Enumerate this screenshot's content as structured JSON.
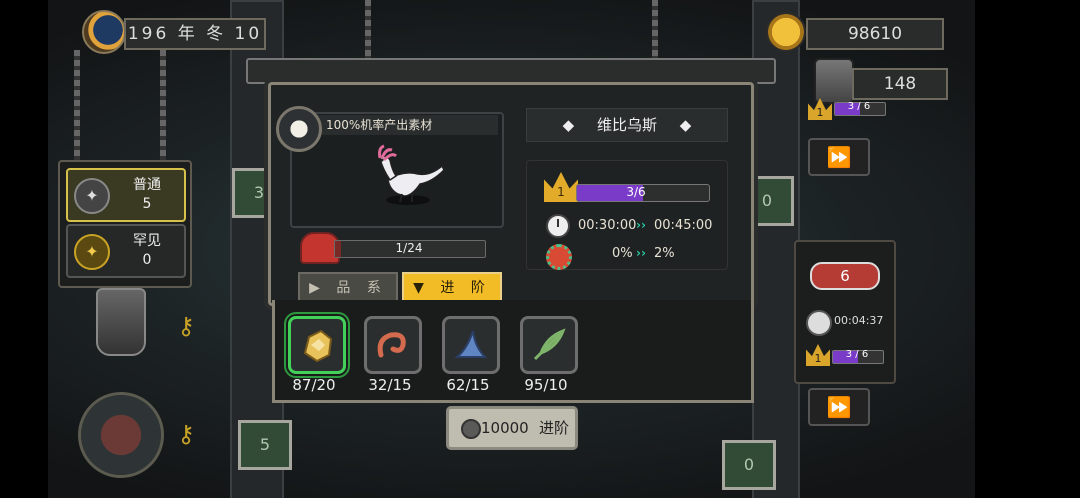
{
  "header": {
    "date": "196 年 冬 10",
    "gold": "98610",
    "barrels": "148"
  },
  "rarity_filter": {
    "items": [
      {
        "label": "普通",
        "count": "5"
      },
      {
        "label": "罕见",
        "count": "0"
      }
    ]
  },
  "right_panel": {
    "top_level_text": "3 / 6",
    "top_level_crown": "1",
    "meat_count": "6",
    "timer": "00:04:37",
    "level_crown": "1",
    "level_text": "3 / 6",
    "level_progress": 0.5
  },
  "side_plates": {
    "left_top": "3",
    "right_top": "0",
    "left_bottom": "5",
    "right_bottom": "0"
  },
  "dialog": {
    "material_header": "100%机率产出素材",
    "drop_progress_text": "1/24",
    "drop_progress": 0.04,
    "creature_name": "维比乌斯",
    "name_left_mark": "◆",
    "name_right_mark": "◆",
    "level_crown": "1",
    "level_text": "3/6",
    "level_progress": 0.5,
    "time_current": "00:30:00",
    "time_next": "00:45:00",
    "rate_current": "0%",
    "rate_next": "2%",
    "arrow_glyph": "››"
  },
  "tabs": [
    {
      "label": "品 系",
      "icon": "▶",
      "active": false
    },
    {
      "label": "进 阶",
      "icon": "▼",
      "active": true
    }
  ],
  "materials": [
    {
      "name": "gold-nugget-icon",
      "count": "87/20",
      "selected": true
    },
    {
      "name": "worm-icon",
      "count": "32/15",
      "selected": false
    },
    {
      "name": "blue-fin-icon",
      "count": "62/15",
      "selected": false
    },
    {
      "name": "green-leaf-icon",
      "count": "95/10",
      "selected": false
    }
  ],
  "advance": {
    "cost": "10000",
    "label": "进阶"
  },
  "colors": {
    "accent_gold": "#f2bc26",
    "level_purple": "#7a3bc8",
    "arrow_teal": "#27c8a0",
    "selected_green": "#44d15a"
  }
}
